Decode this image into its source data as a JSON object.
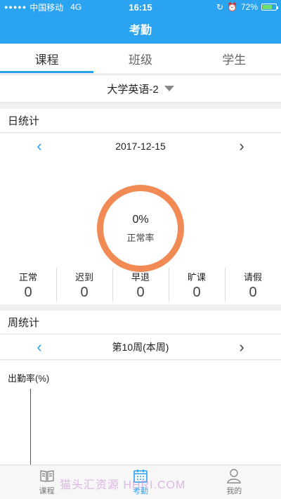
{
  "status_bar": {
    "carrier": "中国移动",
    "network": "4G",
    "time": "16:15",
    "battery": "72%",
    "battery_level": 0.72
  },
  "nav": {
    "title": "考勤"
  },
  "tabs": [
    {
      "label": "课程"
    },
    {
      "label": "班级"
    },
    {
      "label": "学生"
    }
  ],
  "course": {
    "selected": "大学英语-2"
  },
  "daily": {
    "title": "日统计",
    "date": "2017-12-15",
    "rate": "0%",
    "rate_label": "正常率",
    "stats": [
      {
        "label": "正常",
        "value": "0"
      },
      {
        "label": "迟到",
        "value": "0"
      },
      {
        "label": "早退",
        "value": "0"
      },
      {
        "label": "旷课",
        "value": "0"
      },
      {
        "label": "请假",
        "value": "0"
      }
    ]
  },
  "weekly": {
    "title": "周统计",
    "week": "第10周(本周)",
    "chart_ylabel": "出勤率(%)"
  },
  "tab_bar": [
    {
      "label": "课程",
      "icon": "book-icon"
    },
    {
      "label": "考勤",
      "icon": "calendar-icon"
    },
    {
      "label": "我的",
      "icon": "user-icon"
    }
  ],
  "watermark": "猫头汇资源 HHRI.COM",
  "colors": {
    "primary": "#2aa3f0",
    "ring": "#f28a55"
  }
}
